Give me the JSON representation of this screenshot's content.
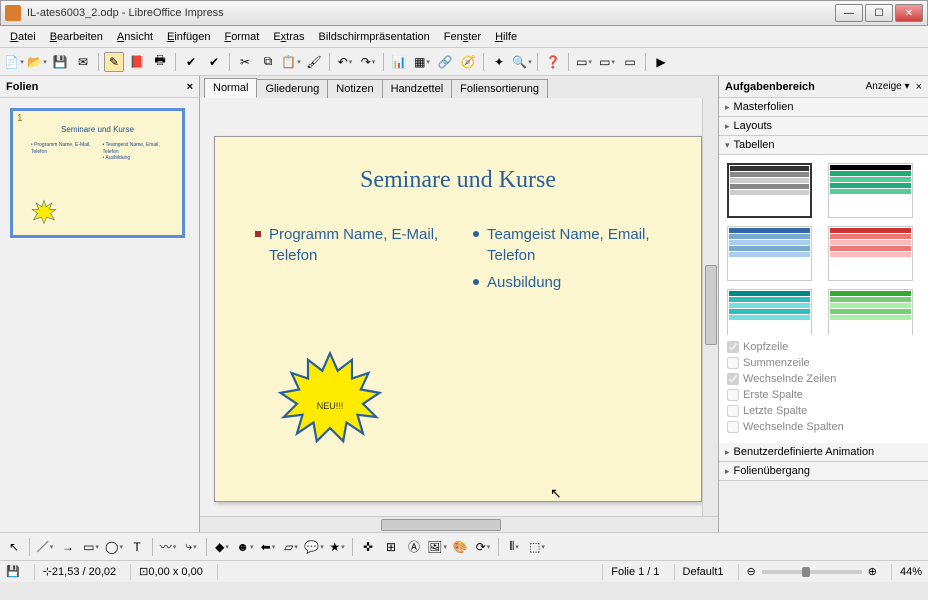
{
  "window": {
    "title": "IL-ates6003_2.odp - LibreOffice Impress"
  },
  "menus": [
    "Datei",
    "Bearbeiten",
    "Ansicht",
    "Einfügen",
    "Format",
    "Extras",
    "Bildschirmpräsentation",
    "Fenster",
    "Hilfe"
  ],
  "left_panel": {
    "title": "Folien"
  },
  "tabs": [
    "Normal",
    "Gliederung",
    "Notizen",
    "Handzettel",
    "Foliensortierung"
  ],
  "active_tab": 0,
  "slide": {
    "number": "1",
    "title": "Seminare und Kurse",
    "left_items": [
      "Programm Name, E-Mail, Telefon"
    ],
    "right_items": [
      "Teamgeist Name, Email, Telefon",
      "Ausbildung"
    ],
    "star_text": "NEU!!!"
  },
  "right_panel": {
    "title": "Aufgabenbereich",
    "view_label": "Anzeige",
    "sections": {
      "master": "Masterfolien",
      "layouts": "Layouts",
      "tables": "Tabellen",
      "anim": "Benutzerdefinierte Animation",
      "trans": "Folienübergang"
    },
    "table_opts": {
      "header": "Kopfzeile",
      "total": "Summenzeile",
      "banded_rows": "Wechselnde Zeilen",
      "first_col": "Erste Spalte",
      "last_col": "Letzte Spalte",
      "banded_cols": "Wechselnde Spalten"
    }
  },
  "status": {
    "coords": "21,53 / 20,02",
    "size": "0,00 x 0,00",
    "slide": "Folie 1 / 1",
    "template": "Default1",
    "zoom": "44%"
  }
}
